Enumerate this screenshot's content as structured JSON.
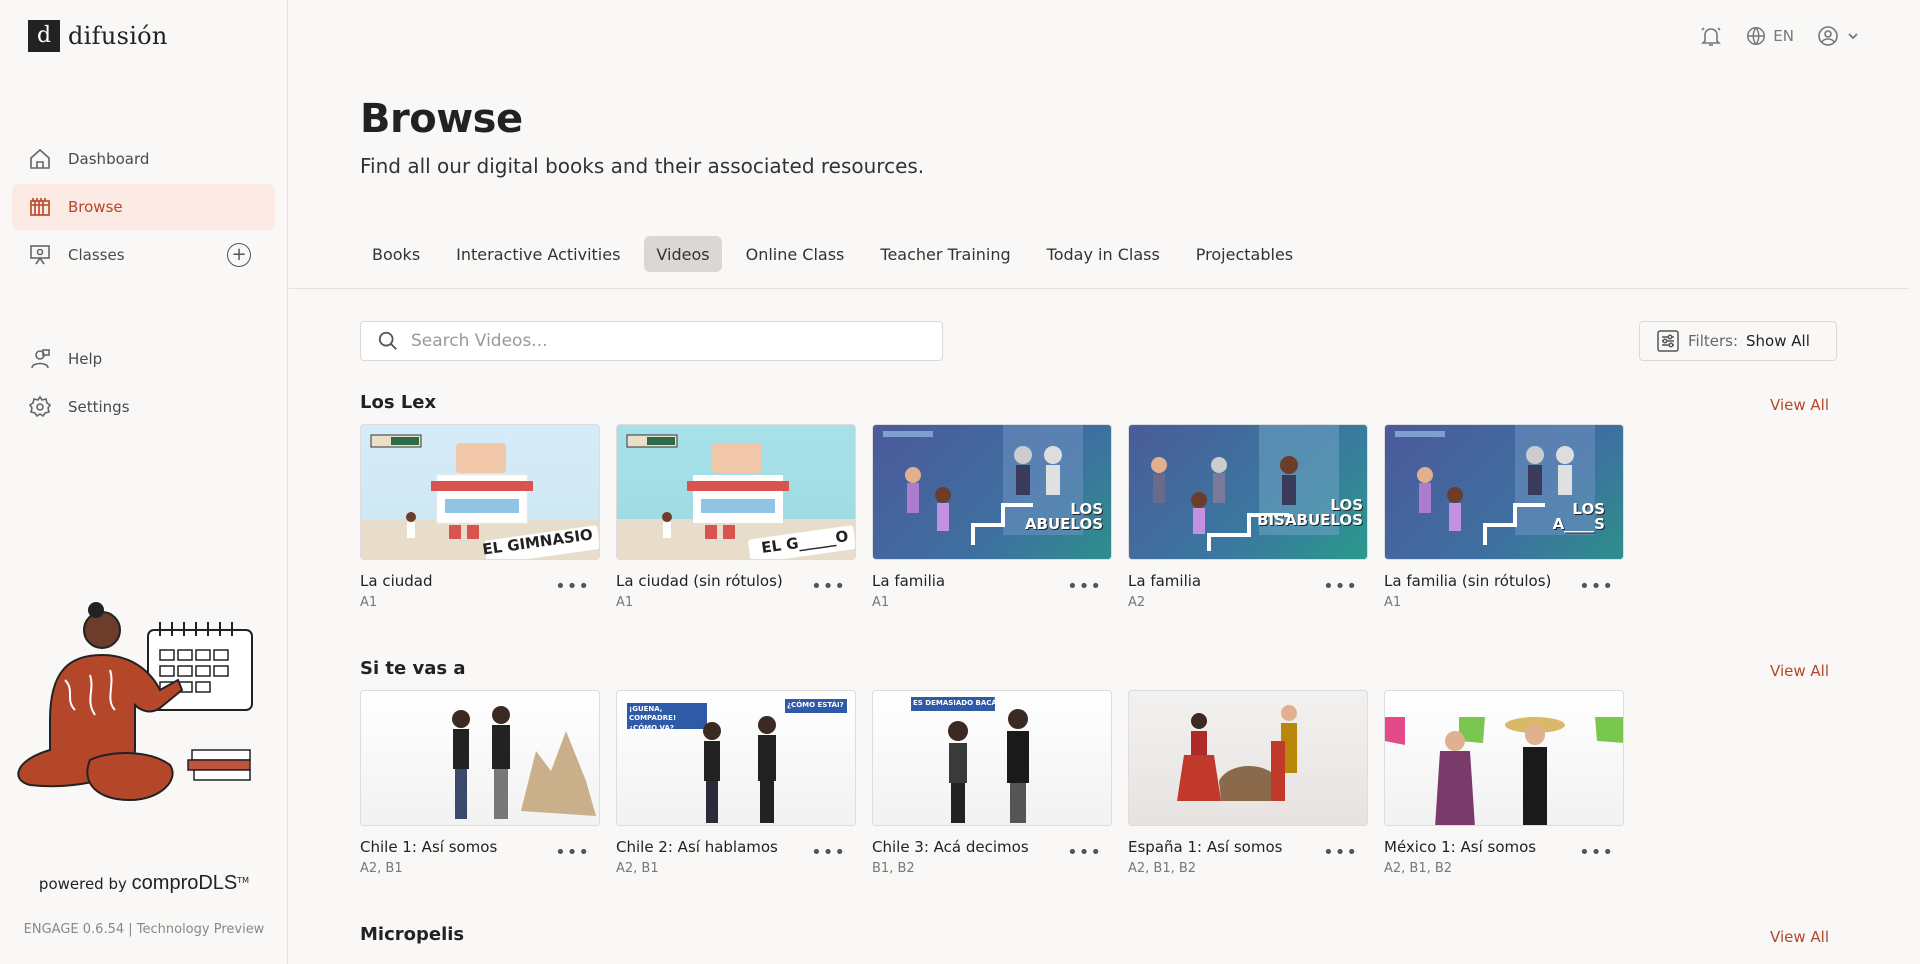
{
  "app": {
    "logo_text": "difusión",
    "logo_mark": "d"
  },
  "sidebar": {
    "items": [
      {
        "label": "Dashboard",
        "icon": "home-icon"
      },
      {
        "label": "Browse",
        "icon": "browse-icon"
      },
      {
        "label": "Classes",
        "icon": "classes-icon"
      },
      {
        "label": "Help",
        "icon": "help-icon"
      },
      {
        "label": "Settings",
        "icon": "gear-icon"
      }
    ],
    "powered_prefix": "powered by",
    "powered_brand": "comproDLS",
    "powered_tm": "TM",
    "version": "ENGAGE 0.6.54 | Technology Preview"
  },
  "topbar": {
    "language": "EN"
  },
  "page": {
    "title": "Browse",
    "subtitle": "Find all our digital books and their associated resources."
  },
  "tabs": [
    {
      "label": "Books"
    },
    {
      "label": "Interactive Activities"
    },
    {
      "label": "Videos",
      "active": true
    },
    {
      "label": "Online Class"
    },
    {
      "label": "Teacher Training"
    },
    {
      "label": "Today in Class"
    },
    {
      "label": "Projectables"
    }
  ],
  "search": {
    "placeholder": "Search Videos..."
  },
  "filters": {
    "label": "Filters:",
    "value": "Show All"
  },
  "view_all_label": "View All",
  "more_label": "•••",
  "sections": [
    {
      "title": "Los Lex",
      "cards": [
        {
          "title": "La ciudad",
          "level": "A1",
          "thumb_text": "EL GIMNASIO"
        },
        {
          "title": "La ciudad (sin rótulos)",
          "level": "A1",
          "thumb_text": "EL G_____O"
        },
        {
          "title": "La familia",
          "level": "A1",
          "thumb_text": "LOS ABUELOS"
        },
        {
          "title": "La familia",
          "level": "A2",
          "thumb_text": "LOS BISABUELOS"
        },
        {
          "title": "La familia (sin rótulos)",
          "level": "A1",
          "thumb_text": "LOS A____S"
        }
      ]
    },
    {
      "title": "Si te vas a",
      "cards": [
        {
          "title": "Chile 1: Así somos",
          "level": "A2, B1"
        },
        {
          "title": "Chile 2: Así hablamos",
          "level": "A2, B1",
          "bubble_a": "¡GUENA, COMPADRE! ¿CÓMO VA?",
          "bubble_b": "¿CÓMO ESTÁI?"
        },
        {
          "title": "Chile 3: Acá decimos",
          "level": "B1, B2",
          "bubble_a": "ES DEMASIADO BACÁN"
        },
        {
          "title": "España 1: Así somos",
          "level": "A2, B1, B2"
        },
        {
          "title": "México 1: Así somos",
          "level": "A2, B1, B2"
        }
      ]
    },
    {
      "title": "Micropelis",
      "cards": []
    }
  ],
  "colors": {
    "accent": "#b4472a",
    "active_bg": "#fbe9e4",
    "background": "#faf8f6"
  }
}
